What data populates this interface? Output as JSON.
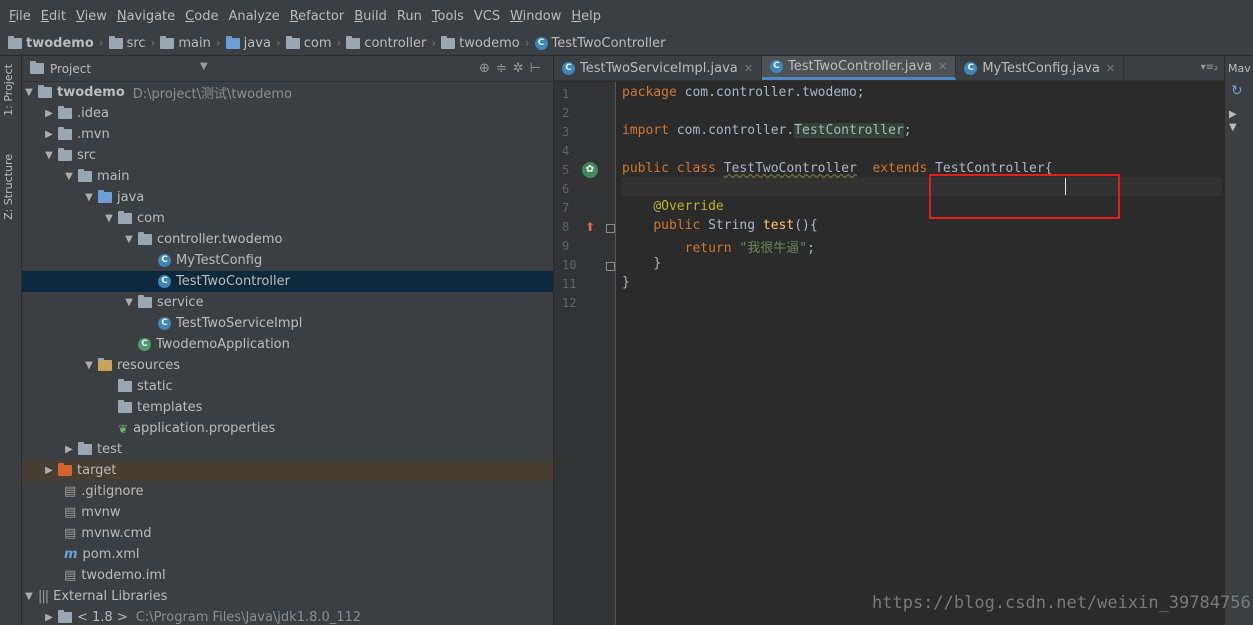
{
  "menu": [
    {
      "mnemonic": "F",
      "rest": "ile"
    },
    {
      "mnemonic": "E",
      "rest": "dit"
    },
    {
      "mnemonic": "V",
      "rest": "iew"
    },
    {
      "mnemonic": "N",
      "rest": "avigate"
    },
    {
      "mnemonic": "C",
      "rest": "ode"
    },
    {
      "mnemonic": "",
      "rest": "Analyze"
    },
    {
      "mnemonic": "R",
      "rest": "efactor"
    },
    {
      "mnemonic": "B",
      "rest": "uild"
    },
    {
      "mnemonic": "",
      "rest": "Run"
    },
    {
      "mnemonic": "T",
      "rest": "ools"
    },
    {
      "mnemonic": "",
      "rest": "VCS"
    },
    {
      "mnemonic": "W",
      "rest": "indow"
    },
    {
      "mnemonic": "H",
      "rest": "elp"
    }
  ],
  "breadcrumb": [
    "twodemo",
    "src",
    "main",
    "java",
    "com",
    "controller",
    "twodemo",
    "TestTwoController"
  ],
  "left_toolbar": {
    "project_tab": "1: Project",
    "structure_tab": "Z: Structure"
  },
  "project_panel": {
    "title": "Project"
  },
  "tree": [
    {
      "label": "twodemo",
      "path": "D:\\project\\测试\\twodemo",
      "bold": true
    },
    {
      "label": ".idea"
    },
    {
      "label": ".mvn"
    },
    {
      "label": "src"
    },
    {
      "label": "main"
    },
    {
      "label": "java"
    },
    {
      "label": "com"
    },
    {
      "label": "controller.twodemo"
    },
    {
      "label": "MyTestConfig"
    },
    {
      "label": "TestTwoController"
    },
    {
      "label": "service"
    },
    {
      "label": "TestTwoServiceImpl"
    },
    {
      "label": "TwodemoApplication"
    },
    {
      "label": "resources"
    },
    {
      "label": "static"
    },
    {
      "label": "templates"
    },
    {
      "label": "application.properties"
    },
    {
      "label": "test"
    },
    {
      "label": "target"
    },
    {
      "label": ".gitignore"
    },
    {
      "label": "mvnw"
    },
    {
      "label": "mvnw.cmd"
    },
    {
      "label": "pom.xml"
    },
    {
      "label": "twodemo.iml"
    },
    {
      "label": "External Libraries"
    },
    {
      "label": "< 1.8 >",
      "path": "C:\\Program Files\\Java\\jdk1.8.0_112"
    }
  ],
  "editor_tabs": [
    {
      "label": "TestTwoServiceImpl.java",
      "active": false
    },
    {
      "label": "TestTwoController.java",
      "active": true
    },
    {
      "label": "MyTestConfig.java",
      "active": false
    }
  ],
  "tabs_more": "▾≡₂",
  "right_panel_label": "Mav",
  "line_numbers": [
    "1",
    "2",
    "3",
    "4",
    "5",
    "6",
    "7",
    "8",
    "9",
    "10",
    "11",
    "12"
  ],
  "code": {
    "l1_kw": "package",
    "l1_rest": " com.controller.twodemo;",
    "l3_kw": "import",
    "l3_pkg": " com.controller.",
    "l3_ref": "TestController",
    "l3_end": ";",
    "l5_kw1": "public",
    "l5_kw2": " class ",
    "l5_name": "TestTwoController",
    "l5_kw3": "  extends ",
    "l5_parent": "TestController",
    "l5_brace": "{",
    "l7_ann": "@Override",
    "l8_kw": "public",
    "l8_type": " String ",
    "l8_fn": "test",
    "l8_end": "(){",
    "l9_kw": "return",
    "l9_str": " \"我很牛逼\"",
    "l9_end": ";",
    "l10": "}",
    "l11": "}"
  },
  "watermark": "https://blog.csdn.net/weixin_39784756",
  "colors": {
    "keyword": "#cc7832",
    "string": "#6a8759",
    "annotation": "#bbb529",
    "function": "#ffc66d",
    "highlight_box": "#e0201a",
    "selection": "#0d293e"
  }
}
